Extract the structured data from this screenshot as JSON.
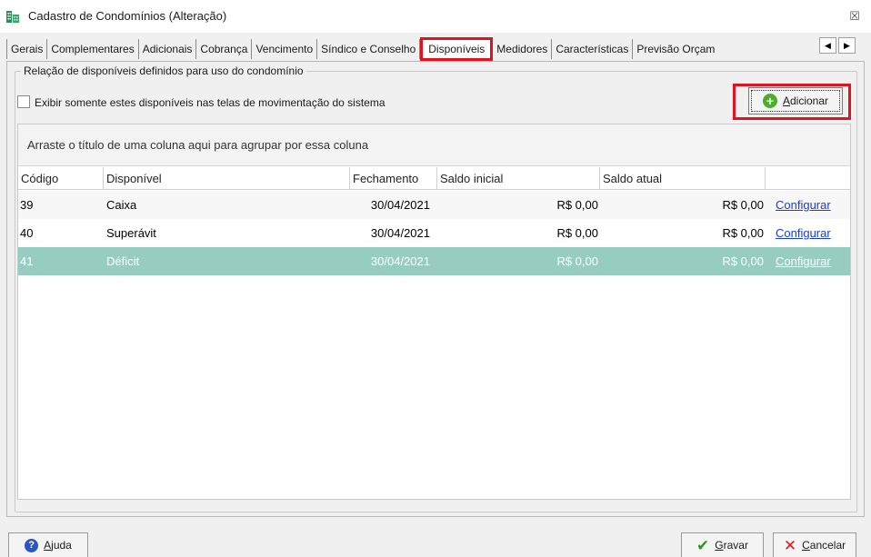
{
  "window": {
    "title": "Cadastro de Condomínios (Alteração)",
    "close_glyph": "☒"
  },
  "tabs": [
    {
      "label": "Gerais"
    },
    {
      "label": "Complementares"
    },
    {
      "label": "Adicionais"
    },
    {
      "label": "Cobrança"
    },
    {
      "label": "Vencimento"
    },
    {
      "label": "Síndico e Conselho"
    },
    {
      "label": "Disponíveis",
      "active": true
    },
    {
      "label": "Medidores"
    },
    {
      "label": "Características"
    },
    {
      "label": "Previsão Orçam"
    }
  ],
  "tab_nav": {
    "prev": "◀",
    "next": "▶"
  },
  "panel": {
    "group_title": "Relação de disponíveis definidos para uso do condomínio",
    "checkbox_label": "Exibir somente estes disponíveis nas telas de movimentação do sistema",
    "add_button": {
      "accel": "A",
      "rest": "dicionar",
      "icon": "plus-circle-icon"
    }
  },
  "grid": {
    "group_hint": "Arraste o título de uma coluna aqui para agrupar por essa coluna",
    "columns": [
      "Código",
      "Disponível",
      "Fechamento",
      "Saldo inicial",
      "Saldo atual",
      ""
    ],
    "rows": [
      {
        "codigo": "39",
        "disponivel": "Caixa",
        "fechamento": "30/04/2021",
        "saldo_inicial": "R$ 0,00",
        "saldo_atual": "R$ 0,00",
        "acao": "Configurar"
      },
      {
        "codigo": "40",
        "disponivel": "Superávit",
        "fechamento": "30/04/2021",
        "saldo_inicial": "R$ 0,00",
        "saldo_atual": "R$ 0,00",
        "acao": "Configurar"
      },
      {
        "codigo": "41",
        "disponivel": "Déficit",
        "fechamento": "30/04/2021",
        "saldo_inicial": "R$ 0,00",
        "saldo_atual": "R$ 0,00",
        "acao": "Configurar",
        "selected": true
      }
    ]
  },
  "footer": {
    "help": {
      "accel": "A",
      "rest": "juda"
    },
    "save": {
      "accel": "G",
      "rest": "ravar"
    },
    "cancel": {
      "accel": "C",
      "rest": "ancelar"
    }
  },
  "colors": {
    "highlight_red": "#e0141e",
    "selected_row": "#97cdc0",
    "link_blue": "#1a3fd6",
    "add_green": "#4caf2a"
  }
}
